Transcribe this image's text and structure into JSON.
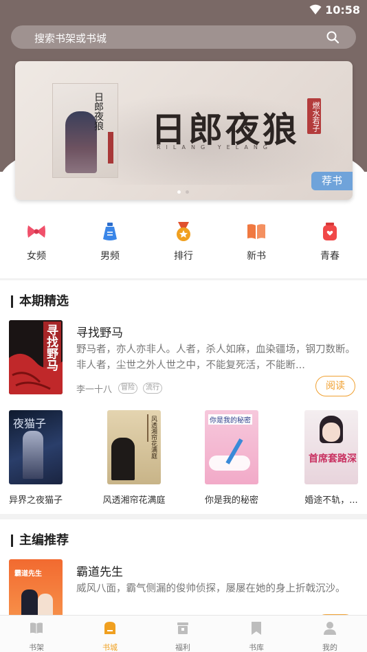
{
  "status_bar": {
    "time": "10:58"
  },
  "search": {
    "placeholder": "搜索书架或书城"
  },
  "banner": {
    "title": "日郎夜狼",
    "subtitle": "RILANG YELANG",
    "seal": "燃水若子",
    "cover_title": "日郎夜狼",
    "tag": "荐书",
    "page_count": 2,
    "active_page": 1
  },
  "categories": [
    {
      "label": "女频",
      "icon": "bow-icon",
      "color": "#f0506a"
    },
    {
      "label": "男频",
      "icon": "male-bottle-icon",
      "color": "#3a86e8"
    },
    {
      "label": "排行",
      "icon": "medal-icon",
      "color": "#f0a020"
    },
    {
      "label": "新书",
      "icon": "open-book-icon",
      "color": "#f07840"
    },
    {
      "label": "青春",
      "icon": "heart-box-icon",
      "color": "#f04848"
    }
  ],
  "section1": {
    "heading": "本期精选",
    "featured": {
      "title": "寻找野马",
      "description": "野马者，亦人亦非人。人者，杀人如麻，血染疆场，钢刀数断。非人者，尘世之外人世之中，不能复死活，不能断...",
      "author": "李一十八",
      "tags": [
        "冒险",
        "流行"
      ],
      "cover_text": "寻找野马",
      "read_label": "阅读"
    },
    "books": [
      {
        "title": "异界之夜猫子",
        "cover_text": "夜猫子"
      },
      {
        "title": "风透湘帘花满庭",
        "cover_text": "风透湘帘花满庭"
      },
      {
        "title": "你是我的秘密",
        "cover_text": "你是我的秘密"
      },
      {
        "title": "婚途不轨，...",
        "cover_text": "首席套路深"
      }
    ]
  },
  "section2": {
    "heading": "主编推荐",
    "featured": {
      "title": "霸道先生",
      "description": "威风八面，霸气侧漏的俊帅侦探，屡屡在她的身上折戟沉沙。",
      "cover_text": "霸道先生"
    }
  },
  "nav": [
    {
      "label": "书架",
      "icon": "bookshelf-icon"
    },
    {
      "label": "书城",
      "icon": "bookstore-icon",
      "active": true
    },
    {
      "label": "福利",
      "icon": "gift-icon"
    },
    {
      "label": "书库",
      "icon": "bookmark-icon"
    },
    {
      "label": "我的",
      "icon": "user-icon"
    }
  ],
  "colors": {
    "header": "#7a6966",
    "accent": "#f0a020",
    "banner_tag": "#6fa3da"
  }
}
